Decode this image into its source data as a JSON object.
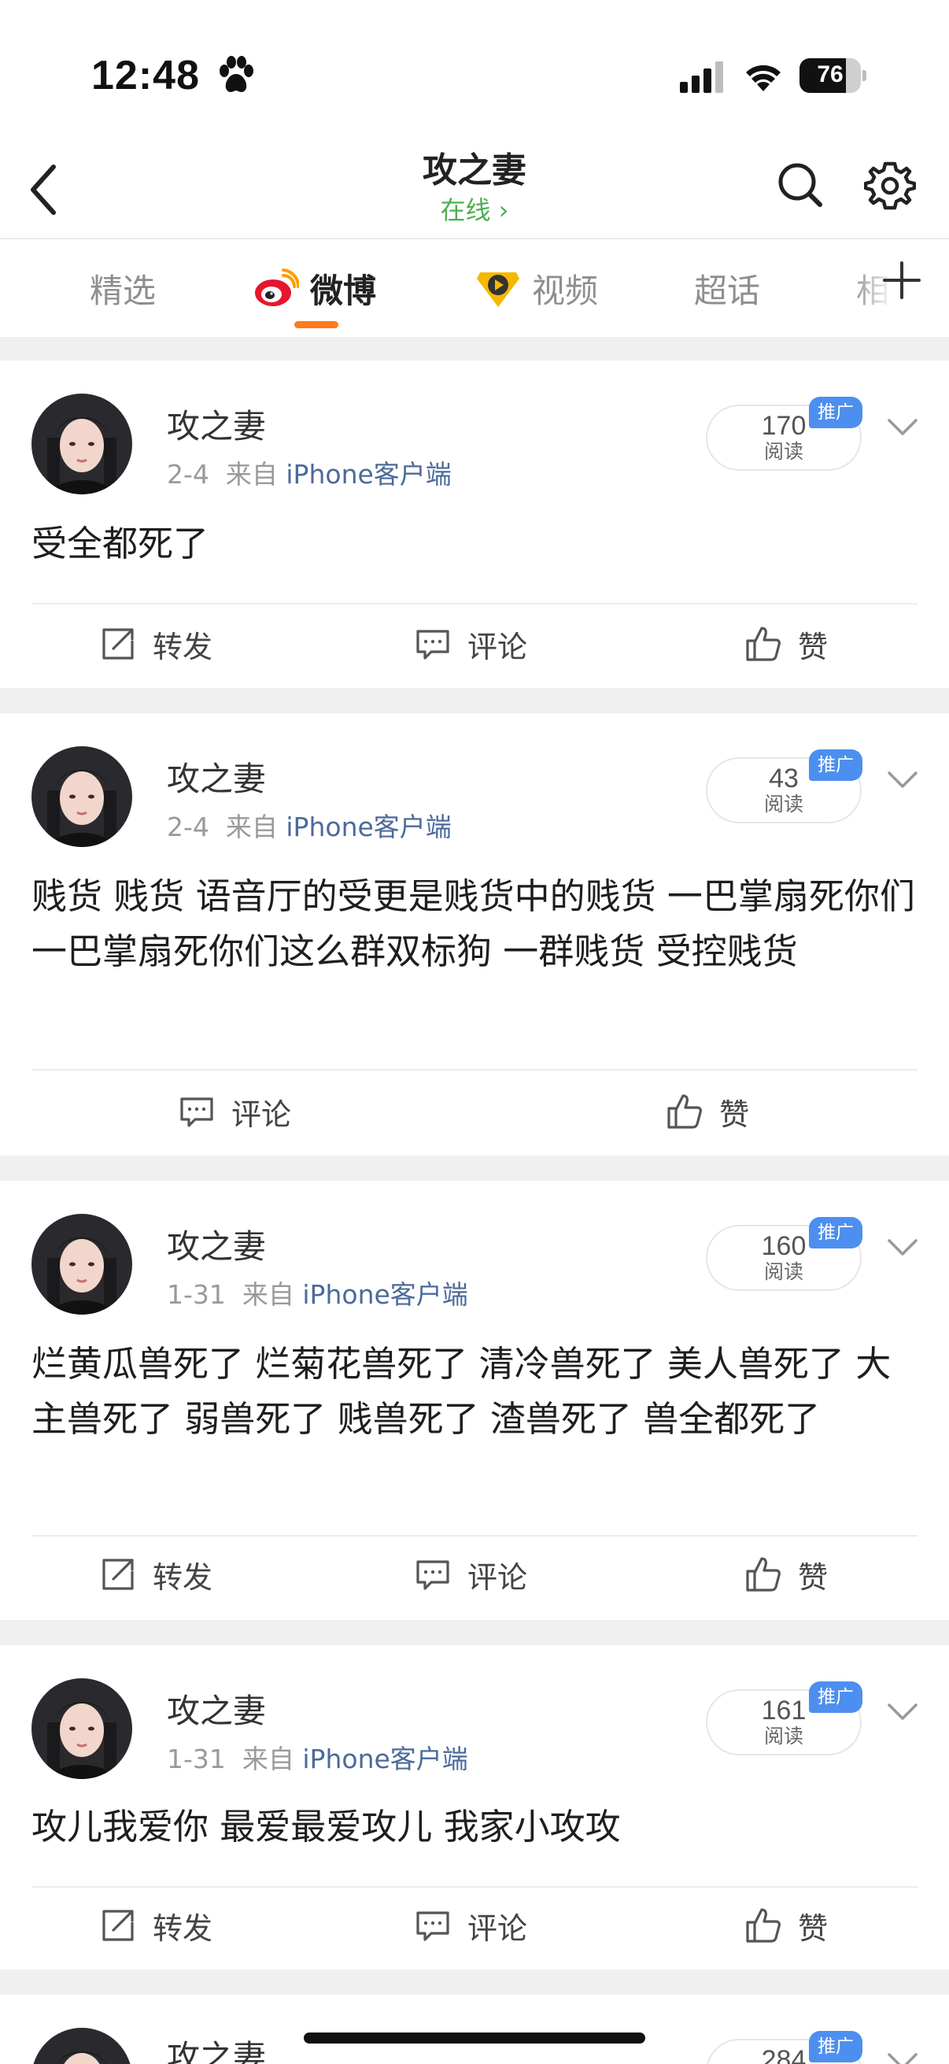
{
  "status_bar": {
    "time": "12:48",
    "battery": "76",
    "battery_level": 0.76
  },
  "header": {
    "title": "攻之妻",
    "subtitle": "在线 ›"
  },
  "tabs": [
    {
      "label": "精选",
      "active": false
    },
    {
      "label": "微博",
      "active": true
    },
    {
      "label": "视频",
      "active": false
    },
    {
      "label": "超话",
      "active": false
    },
    {
      "label": "相",
      "active": false
    }
  ],
  "actions": {
    "repost": "转发",
    "comment": "评论",
    "like": "赞"
  },
  "posts": [
    {
      "author": "攻之妻",
      "date": "2-4",
      "from": "来自",
      "source": "iPhone客户端",
      "reads": "170",
      "reads_label": "阅读",
      "promo": "推广",
      "text": "受全都死了"
    },
    {
      "author": "攻之妻",
      "date": "2-4",
      "from": "来自",
      "source": "iPhone客户端",
      "reads": "43",
      "reads_label": "阅读",
      "promo": "推广",
      "text": "贱货 贱货 语音厅的受更是贱货中的贱货 一巴掌扇死你们 一巴掌扇死你们这么群双标狗 一群贱货 受控贱货"
    },
    {
      "author": "攻之妻",
      "date": "1-31",
      "from": "来自",
      "source": "iPhone客户端",
      "reads": "160",
      "reads_label": "阅读",
      "promo": "推广",
      "text": "烂黄瓜兽死了 烂菊花兽死了 清冷兽死了 美人兽死了 大主兽死了 弱兽死了 贱兽死了 渣兽死了 兽全都死了"
    },
    {
      "author": "攻之妻",
      "date": "1-31",
      "from": "来自",
      "source": "iPhone客户端",
      "reads": "161",
      "reads_label": "阅读",
      "promo": "推广",
      "text": "攻儿我爱你 最爱最爱攻儿 我家小攻攻"
    },
    {
      "author": "攻之妻",
      "reads": "284",
      "promo": "推广"
    }
  ]
}
